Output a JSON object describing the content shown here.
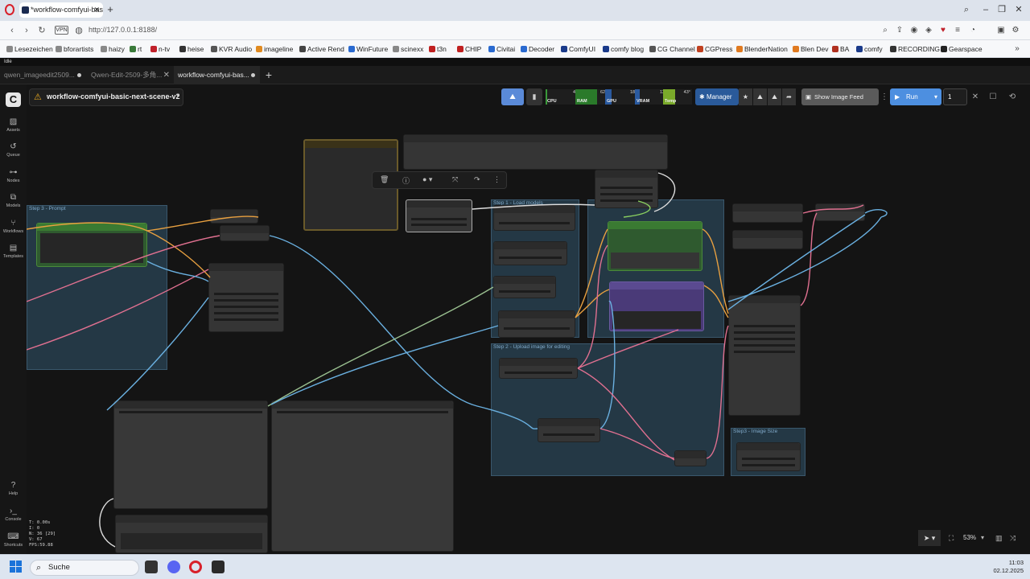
{
  "browser": {
    "tab_title": "*workflow-comfyui-basic-",
    "new_tab": "+",
    "url": "http://127.0.0.1:8188/",
    "vpn": "VPN"
  },
  "bookmarks": [
    {
      "label": "Lesezeichen",
      "color": "#777"
    },
    {
      "label": "bforartists",
      "color": "#777"
    },
    {
      "label": "haizy",
      "color": "#777"
    },
    {
      "label": "rt",
      "color": "#3a7a3a"
    },
    {
      "label": "n-tv",
      "color": "#c0202a"
    },
    {
      "label": "heise",
      "color": "#333"
    },
    {
      "label": "KVR Audio",
      "color": "#555"
    },
    {
      "label": "imageline",
      "color": "#e08a20"
    },
    {
      "label": "Active Rend",
      "color": "#444"
    },
    {
      "label": "WinFuture",
      "color": "#2a6ad0"
    },
    {
      "label": "scinexx",
      "color": "#888"
    },
    {
      "label": "t3n",
      "color": "#c02020"
    },
    {
      "label": "CHIP",
      "color": "#c02020"
    },
    {
      "label": "Civitai",
      "color": "#2a6ad0"
    },
    {
      "label": "Decoder",
      "color": "#2a6ad0"
    },
    {
      "label": "ComfyUI",
      "color": "#1a3a8a"
    },
    {
      "label": "comfy blog",
      "color": "#1a3a8a"
    },
    {
      "label": "CG Channel",
      "color": "#555"
    },
    {
      "label": "CGPress",
      "color": "#c04020"
    },
    {
      "label": "BlenderNation",
      "color": "#e07a20"
    },
    {
      "label": "Blen Dev",
      "color": "#e07a20"
    },
    {
      "label": "BA",
      "color": "#b03020"
    },
    {
      "label": "comfy",
      "color": "#1a3a8a"
    },
    {
      "label": "RECORDING",
      "color": "#333"
    },
    {
      "label": "Gearspace",
      "color": "#222"
    }
  ],
  "app": {
    "status_strip": "Idle",
    "workflow_tabs": [
      {
        "label": "qwen_imageedit2509..."
      },
      {
        "label": "Qwen-Edit-2509-多角..."
      },
      {
        "label": "workflow-comfyui-bas..."
      }
    ],
    "workflow_title": "workflow-comfyui-basic-next-scene-v2",
    "sidebar": [
      {
        "label": "Assets",
        "icon": "image-icon"
      },
      {
        "label": "Queue",
        "icon": "history-icon"
      },
      {
        "label": "Nodes",
        "icon": "nodes-icon"
      },
      {
        "label": "Models",
        "icon": "models-icon"
      },
      {
        "label": "Workflows",
        "icon": "workflows-icon"
      },
      {
        "label": "Templates",
        "icon": "templates-icon"
      },
      {
        "label": "Help",
        "icon": "help-icon"
      },
      {
        "label": "Console",
        "icon": "console-icon"
      },
      {
        "label": "Shortcuts",
        "icon": "keyboard-icon"
      }
    ],
    "stats": [
      "T: 0.00s",
      "I: 0",
      "N: 36 [29]",
      "V: 67",
      "FPS:59.88"
    ],
    "monitor": {
      "cpu": {
        "label": "CPU",
        "value": "4%",
        "level": 0.04
      },
      "ram": {
        "label": "RAM",
        "value": "62%",
        "level": 0.62
      },
      "gpu": {
        "label": "GPU",
        "value": "18%",
        "level": 0.18
      },
      "vram": {
        "label": "VRAM",
        "value": "13%",
        "level": 0.13
      },
      "temp": {
        "label": "Temp",
        "value": "43°",
        "level": 0.43
      }
    },
    "manager_label": "Manager",
    "feed_label": "Show Image Feed",
    "run_label": "Run",
    "run_count": "1",
    "zoom": "53%",
    "groups": [
      {
        "title": "Step 3 - Prompt"
      },
      {
        "title": "Step 1 - Load models"
      },
      {
        "title": "Step 2 - Upload image for editing"
      },
      {
        "title": "Step3 - Image Size"
      }
    ]
  },
  "taskbar": {
    "search": "Suche",
    "time": "11:03",
    "date": "02.12.2025"
  },
  "colors": {
    "canvas": "#141414",
    "accent": "#4d8fe0",
    "group": "#32556e",
    "link_orange": "#e8a040",
    "link_pink": "#e07090",
    "link_blue": "#6ab0e0",
    "link_green": "#8ad060"
  }
}
